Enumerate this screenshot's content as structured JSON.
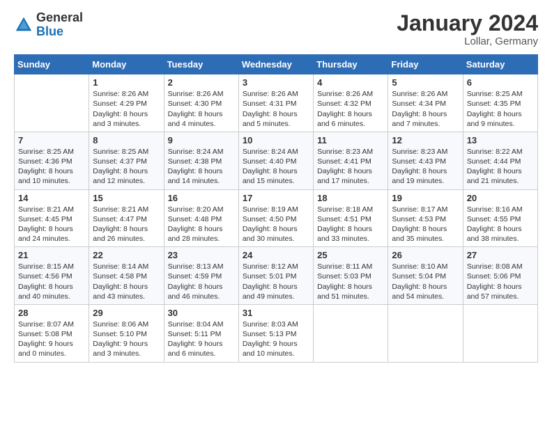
{
  "header": {
    "logo": {
      "general": "General",
      "blue": "Blue"
    },
    "title": "January 2024",
    "location": "Lollar, Germany"
  },
  "calendar": {
    "days_of_week": [
      "Sunday",
      "Monday",
      "Tuesday",
      "Wednesday",
      "Thursday",
      "Friday",
      "Saturday"
    ],
    "weeks": [
      [
        {
          "day": "",
          "info": ""
        },
        {
          "day": "1",
          "info": "Sunrise: 8:26 AM\nSunset: 4:29 PM\nDaylight: 8 hours\nand 3 minutes."
        },
        {
          "day": "2",
          "info": "Sunrise: 8:26 AM\nSunset: 4:30 PM\nDaylight: 8 hours\nand 4 minutes."
        },
        {
          "day": "3",
          "info": "Sunrise: 8:26 AM\nSunset: 4:31 PM\nDaylight: 8 hours\nand 5 minutes."
        },
        {
          "day": "4",
          "info": "Sunrise: 8:26 AM\nSunset: 4:32 PM\nDaylight: 8 hours\nand 6 minutes."
        },
        {
          "day": "5",
          "info": "Sunrise: 8:26 AM\nSunset: 4:34 PM\nDaylight: 8 hours\nand 7 minutes."
        },
        {
          "day": "6",
          "info": "Sunrise: 8:25 AM\nSunset: 4:35 PM\nDaylight: 8 hours\nand 9 minutes."
        }
      ],
      [
        {
          "day": "7",
          "info": "Sunrise: 8:25 AM\nSunset: 4:36 PM\nDaylight: 8 hours\nand 10 minutes."
        },
        {
          "day": "8",
          "info": "Sunrise: 8:25 AM\nSunset: 4:37 PM\nDaylight: 8 hours\nand 12 minutes."
        },
        {
          "day": "9",
          "info": "Sunrise: 8:24 AM\nSunset: 4:38 PM\nDaylight: 8 hours\nand 14 minutes."
        },
        {
          "day": "10",
          "info": "Sunrise: 8:24 AM\nSunset: 4:40 PM\nDaylight: 8 hours\nand 15 minutes."
        },
        {
          "day": "11",
          "info": "Sunrise: 8:23 AM\nSunset: 4:41 PM\nDaylight: 8 hours\nand 17 minutes."
        },
        {
          "day": "12",
          "info": "Sunrise: 8:23 AM\nSunset: 4:43 PM\nDaylight: 8 hours\nand 19 minutes."
        },
        {
          "day": "13",
          "info": "Sunrise: 8:22 AM\nSunset: 4:44 PM\nDaylight: 8 hours\nand 21 minutes."
        }
      ],
      [
        {
          "day": "14",
          "info": "Sunrise: 8:21 AM\nSunset: 4:45 PM\nDaylight: 8 hours\nand 24 minutes."
        },
        {
          "day": "15",
          "info": "Sunrise: 8:21 AM\nSunset: 4:47 PM\nDaylight: 8 hours\nand 26 minutes."
        },
        {
          "day": "16",
          "info": "Sunrise: 8:20 AM\nSunset: 4:48 PM\nDaylight: 8 hours\nand 28 minutes."
        },
        {
          "day": "17",
          "info": "Sunrise: 8:19 AM\nSunset: 4:50 PM\nDaylight: 8 hours\nand 30 minutes."
        },
        {
          "day": "18",
          "info": "Sunrise: 8:18 AM\nSunset: 4:51 PM\nDaylight: 8 hours\nand 33 minutes."
        },
        {
          "day": "19",
          "info": "Sunrise: 8:17 AM\nSunset: 4:53 PM\nDaylight: 8 hours\nand 35 minutes."
        },
        {
          "day": "20",
          "info": "Sunrise: 8:16 AM\nSunset: 4:55 PM\nDaylight: 8 hours\nand 38 minutes."
        }
      ],
      [
        {
          "day": "21",
          "info": "Sunrise: 8:15 AM\nSunset: 4:56 PM\nDaylight: 8 hours\nand 40 minutes."
        },
        {
          "day": "22",
          "info": "Sunrise: 8:14 AM\nSunset: 4:58 PM\nDaylight: 8 hours\nand 43 minutes."
        },
        {
          "day": "23",
          "info": "Sunrise: 8:13 AM\nSunset: 4:59 PM\nDaylight: 8 hours\nand 46 minutes."
        },
        {
          "day": "24",
          "info": "Sunrise: 8:12 AM\nSunset: 5:01 PM\nDaylight: 8 hours\nand 49 minutes."
        },
        {
          "day": "25",
          "info": "Sunrise: 8:11 AM\nSunset: 5:03 PM\nDaylight: 8 hours\nand 51 minutes."
        },
        {
          "day": "26",
          "info": "Sunrise: 8:10 AM\nSunset: 5:04 PM\nDaylight: 8 hours\nand 54 minutes."
        },
        {
          "day": "27",
          "info": "Sunrise: 8:08 AM\nSunset: 5:06 PM\nDaylight: 8 hours\nand 57 minutes."
        }
      ],
      [
        {
          "day": "28",
          "info": "Sunrise: 8:07 AM\nSunset: 5:08 PM\nDaylight: 9 hours\nand 0 minutes."
        },
        {
          "day": "29",
          "info": "Sunrise: 8:06 AM\nSunset: 5:10 PM\nDaylight: 9 hours\nand 3 minutes."
        },
        {
          "day": "30",
          "info": "Sunrise: 8:04 AM\nSunset: 5:11 PM\nDaylight: 9 hours\nand 6 minutes."
        },
        {
          "day": "31",
          "info": "Sunrise: 8:03 AM\nSunset: 5:13 PM\nDaylight: 9 hours\nand 10 minutes."
        },
        {
          "day": "",
          "info": ""
        },
        {
          "day": "",
          "info": ""
        },
        {
          "day": "",
          "info": ""
        }
      ]
    ]
  }
}
